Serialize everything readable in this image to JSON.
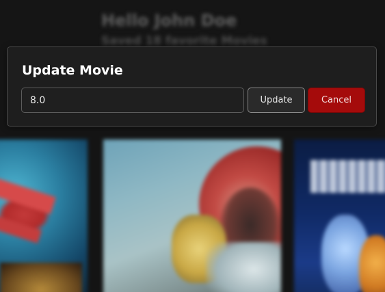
{
  "background": {
    "greeting": "Hello John Doe",
    "subheading": "Saved 18 favorite Movies"
  },
  "modal": {
    "title": "Update Movie",
    "input_value": "8.0",
    "update_label": "Update",
    "cancel_label": "Cancel"
  },
  "colors": {
    "page_background": "#151515",
    "modal_background": "#1e1e1e",
    "cancel_button": "#a50b0b",
    "update_button_border": "#8a8a8a"
  }
}
